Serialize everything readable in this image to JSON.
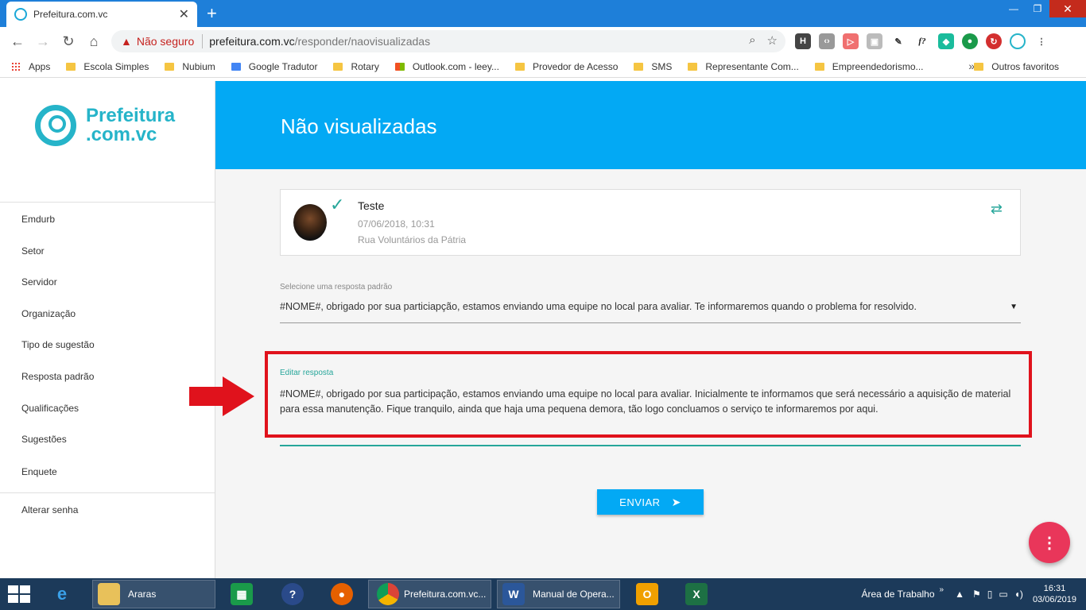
{
  "browser": {
    "tab_title": "Prefeitura.com.vc",
    "security_label": "Não seguro",
    "url_host": "prefeitura.com.vc",
    "url_path": "/responder/naovisualizadas",
    "bookmarks": [
      "Apps",
      "Escola Simples",
      "Nubium",
      "Google Tradutor",
      "Rotary",
      "Outlook.com - leey...",
      "Provedor de Acesso",
      "SMS",
      "Representante Com...",
      "Empreendedorismo..."
    ],
    "other_bookmarks": "Outros favoritos"
  },
  "sidebar": {
    "logo_line1": "Prefeitura",
    "logo_line2": ".com.vc",
    "items": [
      "Emdurb",
      "Setor",
      "Servidor",
      "Organização",
      "Tipo de sugestão",
      "Resposta padrão",
      "Qualificações",
      "Sugestões",
      "Enquete"
    ],
    "change_password": "Alterar senha"
  },
  "page": {
    "title": "Não visualizadas",
    "card": {
      "title": "Teste",
      "date": "07/06/2018, 10:31",
      "address": "Rua Voluntários da Pátria"
    },
    "select_label": "Selecione uma resposta padrão",
    "select_value": "#NOME#, obrigado por sua particiapção, estamos enviando uma equipe no local para avaliar. Te informaremos quando o problema for resolvido.",
    "edit_label": "Editar resposta",
    "edit_text": "#NOME#, obrigado por sua participação, estamos enviando uma equipe no local para avaliar. Inicialmente te informamos que será necessário a aquisição de material para essa manutenção. Fique tranquilo, ainda que haja uma pequena demora, tão logo concluamos o serviço te informaremos por aqui.",
    "send_label": "ENVIAR",
    "fab_icon": "⋮"
  },
  "taskbar": {
    "items": [
      "Araras",
      "Prefeitura.com.vc...",
      "Manual de Opera..."
    ],
    "desktop_label": "Área de Trabalho",
    "time": "16:31",
    "date": "03/06/2019"
  },
  "colors": {
    "brand": "#26b4c9",
    "header": "#03a9f4",
    "accent": "#26a69a",
    "annotation": "#e0121c",
    "fab": "#e9365a"
  }
}
